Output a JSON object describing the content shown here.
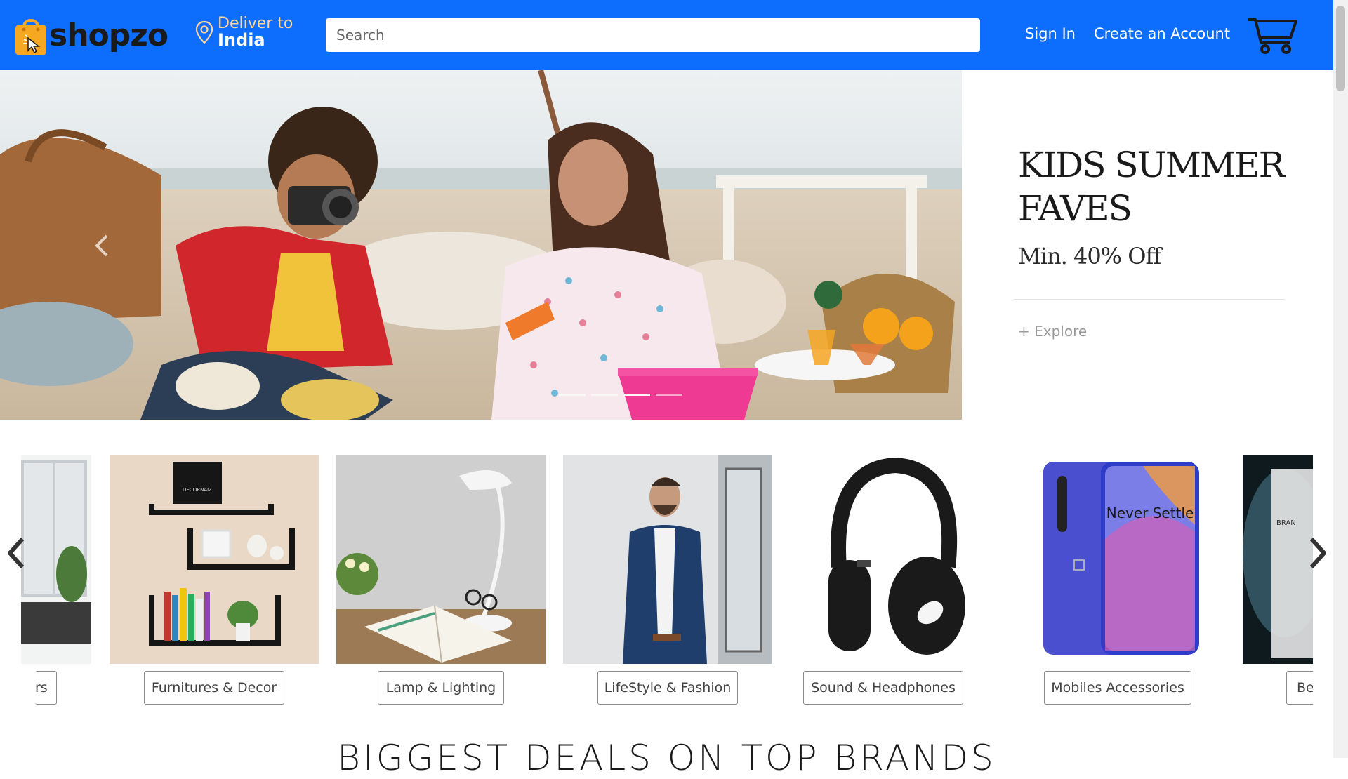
{
  "header": {
    "brand": "shopzo",
    "deliver_label": "Deliver to",
    "deliver_location": "India",
    "search_placeholder": "Search",
    "sign_in": "Sign In",
    "create_account": "Create an Account"
  },
  "hero": {
    "title": "KIDS SUMMER FAVES",
    "subtitle": "Min. 40% Off",
    "cta": "+ Explore"
  },
  "categories": [
    {
      "label": "rs"
    },
    {
      "label": "Furnitures & Decor"
    },
    {
      "label": "Lamp & Lighting"
    },
    {
      "label": "LifeStyle & Fashion"
    },
    {
      "label": "Sound & Headphones"
    },
    {
      "label": "Mobiles Accessories"
    },
    {
      "label": "Be"
    }
  ],
  "phone_text": "Never Settle",
  "decor_text": "DECORNAIZ",
  "beauty_text": "BRAN",
  "section_title": "BIGGEST DEALS ON TOP BRANDS",
  "colors": {
    "header_bg": "#0d6efd",
    "bag_orange": "#f7a823",
    "deliver_label": "#ffd6a0"
  }
}
